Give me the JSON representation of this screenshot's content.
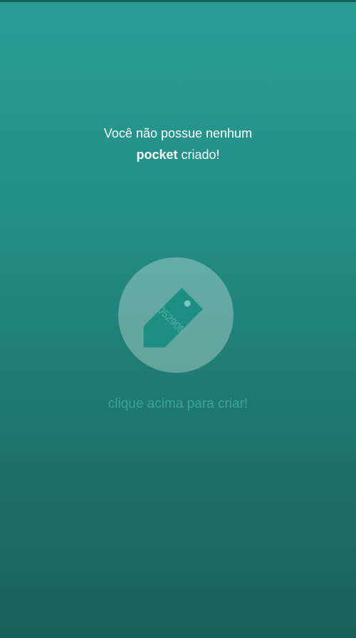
{
  "empty_state": {
    "message_line1": "Você não possue nenhum",
    "message_bold": "pocket",
    "message_rest": " criado!",
    "tag_code": "052905",
    "hint": "clique acima para criar!"
  },
  "colors": {
    "background_top": "#289e96",
    "background_bottom": "#1a605a",
    "tag_fill": "#1e8d84",
    "hint_text": "#3aa59b"
  }
}
